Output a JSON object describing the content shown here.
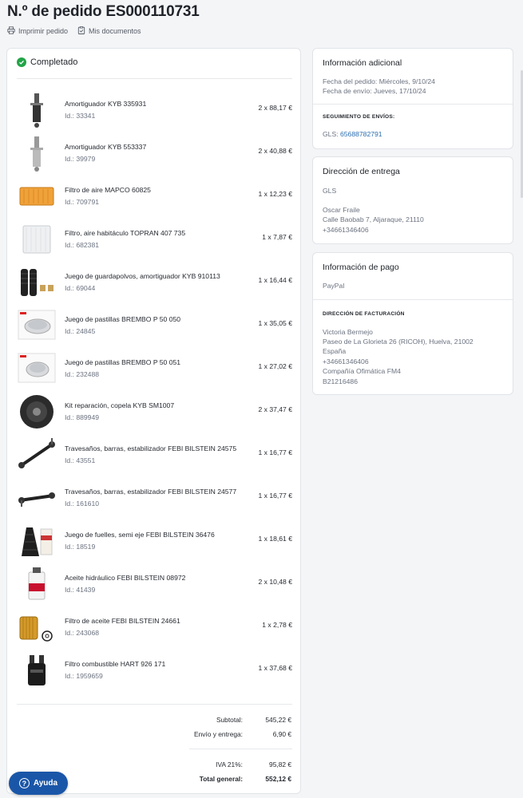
{
  "order": {
    "title": "N.º de pedido ES000110731",
    "print_label": "Imprimir pedido",
    "docs_label": "Mis documentos",
    "status": "Completado"
  },
  "items": [
    {
      "name": "Amortiguador KYB 335931",
      "id": "Id.: 33341",
      "qty": "2 x 88,17 €"
    },
    {
      "name": "Amortiguador KYB 553337",
      "id": "Id.: 39979",
      "qty": "2 x 40,88 €"
    },
    {
      "name": "Filtro de aire MAPCO 60825",
      "id": "Id.: 709791",
      "qty": "1 x 12,23 €"
    },
    {
      "name": "Filtro, aire habitáculo TOPRAN 407 735",
      "id": "Id.: 682381",
      "qty": "1 x 7,87 €"
    },
    {
      "name": "Juego de guardapolvos, amortiguador KYB 910113",
      "id": "Id.: 69044",
      "qty": "1 x 16,44 €"
    },
    {
      "name": "Juego de pastillas BREMBO P 50 050",
      "id": "Id.: 24845",
      "qty": "1 x 35,05 €"
    },
    {
      "name": "Juego de pastillas BREMBO P 50 051",
      "id": "Id.: 232488",
      "qty": "1 x 27,02 €"
    },
    {
      "name": "Kit reparación, copela KYB SM1007",
      "id": "Id.: 889949",
      "qty": "2 x 37,47 €"
    },
    {
      "name": "Travesaños, barras, estabilizador FEBI BILSTEIN 24575",
      "id": "Id.: 43551",
      "qty": "1 x 16,77 €"
    },
    {
      "name": "Travesaños, barras, estabilizador FEBI BILSTEIN 24577",
      "id": "Id.: 161610",
      "qty": "1 x 16,77 €"
    },
    {
      "name": "Juego de fuelles, semi eje FEBI BILSTEIN 36476",
      "id": "Id.: 18519",
      "qty": "1 x 18,61 €"
    },
    {
      "name": "Aceite hidráulico FEBI BILSTEIN 08972",
      "id": "Id.: 41439",
      "qty": "2 x 10,48 €"
    },
    {
      "name": "Filtro de aceite FEBI BILSTEIN 24661",
      "id": "Id.: 243068",
      "qty": "1 x 2,78 €"
    },
    {
      "name": "Filtro combustible HART 926 171",
      "id": "Id.: 1959659",
      "qty": "1 x 37,68 €"
    }
  ],
  "totals": {
    "subtotal_label": "Subtotal:",
    "subtotal": "545,22 €",
    "shipping_label": "Envío y entrega:",
    "shipping": "6,90 €",
    "tax_label": "IVA 21%:",
    "tax": "95,82 €",
    "total_label": "Total general:",
    "total": "552,12 €"
  },
  "info": {
    "heading": "Información adicional",
    "order_date": "Fecha del pedido: Miércoles, 9/10/24",
    "ship_date": "Fecha de envío: Jueves, 17/10/24",
    "tracking_heading": "SEGUIMIENTO DE ENVÍOS:",
    "tracking_prefix": "GLS:",
    "tracking_number": "65688782791"
  },
  "delivery": {
    "heading": "Dirección de entrega",
    "carrier": "GLS",
    "name": "Oscar Fraile",
    "street": "Calle Baobab 7, Aljaraque, 21110",
    "phone": "+34661346406"
  },
  "payment": {
    "heading": "Información de pago",
    "method": "PayPal",
    "billing_heading": "DIRECCIÓN DE FACTURACIÓN",
    "name": "Victoria Bermejo",
    "street": "Paseo de La Glorieta 26 (RICOH), Huelva, 21002",
    "country": "España",
    "phone": "+34661346406",
    "company": "Compañía Ofimática FM4",
    "tax_id": "B21216486"
  },
  "help_label": "Ayuda",
  "colors": {
    "accent": "#1a56a8",
    "success": "#22a447",
    "link": "#2a6db0"
  }
}
